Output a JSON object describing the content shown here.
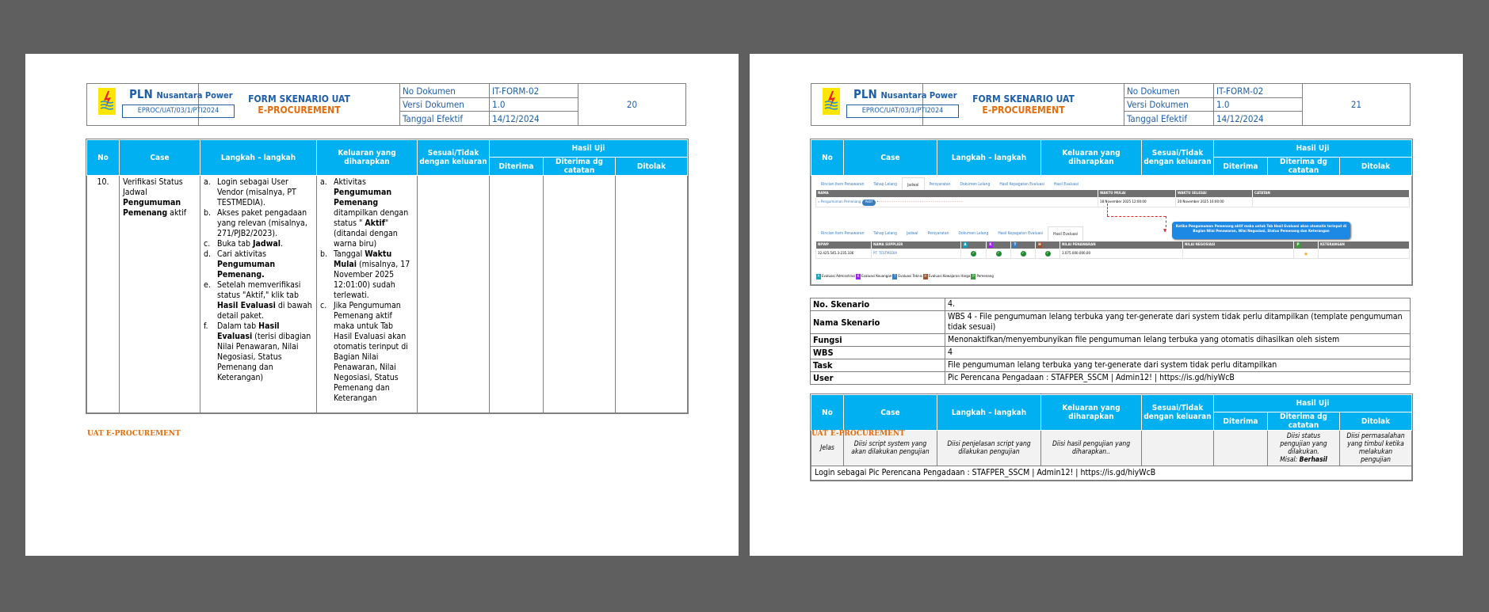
{
  "header": {
    "company": "PLN",
    "company_sub": "Nusantara Power",
    "doc_code": "EPROC/UAT/03/1/PTI2024",
    "form_title": "FORM SKENARIO UAT",
    "form_subtitle": "E-PROCUREMENT",
    "labels": [
      "No Dokumen",
      "Versi Dokumen",
      "Tanggal Efektif"
    ],
    "values": [
      "IT-FORM-02",
      "1.0",
      "14/12/2024"
    ]
  },
  "columns": {
    "no": "No",
    "case": "Case",
    "langkah": "Langkah – langkah",
    "keluaran": "Keluaran yang diharapkan",
    "sesuai": "Sesuai/Tidak dengan keluaran",
    "hasil": "Hasil Uji",
    "diterima": "Diterima",
    "catatan": "Diterima dg catatan",
    "ditolak": "Ditolak"
  },
  "footer": "UAT E-PROCUREMENT",
  "page1": {
    "page_number": "20",
    "row": {
      "no": "10.",
      "case": [
        [
          "Verifikasi Status Jadwal ",
          false
        ],
        [
          "Pengumuman Pemenang",
          true
        ],
        [
          " aktif",
          false
        ]
      ],
      "steps": [
        {
          "m": "a.",
          "t": [
            [
              "Login sebagai User Vendor (misalnya, PT TESTMEDIA).",
              false
            ]
          ]
        },
        {
          "m": "b.",
          "t": [
            [
              "Akses paket pengadaan yang relevan (misalnya, 271/PJB2/2023).",
              false
            ]
          ]
        },
        {
          "m": "c.",
          "t": [
            [
              "Buka tab ",
              false
            ],
            [
              "Jadwal",
              true
            ],
            [
              ".",
              false
            ]
          ]
        },
        {
          "m": "d.",
          "t": [
            [
              "Cari aktivitas ",
              false
            ],
            [
              "Pengumuman Pemenang.",
              true
            ]
          ]
        },
        {
          "m": "e.",
          "t": [
            [
              "Setelah memverifikasi status \"Aktif,\" klik tab ",
              false
            ],
            [
              "Hasil Evaluasi",
              true
            ],
            [
              " di bawah detail paket.",
              false
            ]
          ]
        },
        {
          "m": "f.",
          "t": [
            [
              "Dalam tab ",
              false
            ],
            [
              "Hasil Evaluasi",
              true
            ],
            [
              " (terisi dibagian Nilai Penawaran, Nilai Negosiasi, Status Pemenang dan Keterangan)",
              false
            ]
          ]
        }
      ],
      "outputs": [
        {
          "m": "a.",
          "t": [
            [
              "Aktivitas ",
              false
            ],
            [
              "Pengumuman Pemenang",
              true
            ],
            [
              " ditampilkan dengan status \" ",
              false
            ],
            [
              "Aktif",
              true
            ],
            [
              "\" (ditandai dengan warna biru)",
              false
            ]
          ]
        },
        {
          "m": "b.",
          "t": [
            [
              "Tanggal ",
              false
            ],
            [
              "Waktu Mulai",
              true
            ],
            [
              " (misalnya, 17 November 2025 12:01:00) sudah terlewati.",
              false
            ]
          ]
        },
        {
          "m": "c.",
          "t": [
            [
              "Jika Pengumuman Pemenang aktif maka untuk Tab Hasil Evaluasi akan otomatis terinput di Bagian Nilai Penawaran, Nilai Negosiasi, Status Pemenang dan Keterangan",
              false
            ]
          ]
        }
      ]
    }
  },
  "page2": {
    "page_number": "21",
    "screenshot": {
      "tabs1": [
        "Rincian Item Penawaran",
        "Tahap Lelang",
        "Jadwal",
        "Persyaratan",
        "Dokumen Lelang",
        "Hasil Kepagatan Evaluasi",
        "Hasil Evaluasi"
      ],
      "active1": "Jadwal",
      "sched_headers": [
        "NAMA",
        "WAKTU MULAI",
        "WAKTU SELESAI",
        "CATATAN"
      ],
      "sched_row": {
        "name": "» Pengumuman Pemenang",
        "badge": "Aktif",
        "start": "18 November 2025 12:00:00",
        "end": "20 November 2025 16:00:00"
      },
      "callout": "Ketika Pengumuman Pemenang aktif maka untuk Tab Hasil Evaluasi akan otomatis terinput di Bagian Nilai Penawaran, Nilai Negosiasi, Status Pemenang dan Keterangan",
      "tabs2": [
        "Rincian Item Penawaran",
        "Tahap Lelang",
        "Jadwal",
        "Persyaratan",
        "Dokumen Lelang",
        "Hasil Kepagatan Evaluasi",
        "Hasil Evaluasi"
      ],
      "active2": "Hasil Evaluasi",
      "eval_headers": [
        "NPWP",
        "NAMA SUPPLIER",
        "A",
        "K",
        "T",
        "H",
        "NILAI PENAWARAN",
        "NILAI NEGOSIASI",
        "P",
        "KETERANGAN"
      ],
      "eval_row": {
        "npwp": "32.425.545.3-235.336",
        "supplier": "PT. TESTMEDIA",
        "penawaran": "3.075.000.000,00"
      },
      "legend": [
        {
          "k": "A",
          "label": "Evaluasi Adminstrasi",
          "color": "#17a2b8"
        },
        {
          "k": "K",
          "label": "Evaluasi Keuangan",
          "color": "#a020f0"
        },
        {
          "k": "T",
          "label": "Evaluasi Teknis",
          "color": "#3a7ec2"
        },
        {
          "k": "H",
          "label": "Evaluasi Kewajaran Harga",
          "color": "#a0522d"
        },
        {
          "k": "P",
          "label": "Pemenang",
          "color": "#3c9a3c"
        }
      ]
    },
    "skenario": [
      {
        "k": "No. Skenario",
        "v": "4."
      },
      {
        "k": "Nama Skenario",
        "v": "WBS 4 - File pengumuman lelang terbuka yang ter-generate dari system tidak perlu ditampilkan (template pengumuman tidak sesuai)"
      },
      {
        "k": "Fungsi",
        "v": "Menonaktifkan/menyembunyikan file pengumuman lelang terbuka yang otomatis dihasilkan oleh sistem"
      },
      {
        "k": "WBS",
        "v": "4"
      },
      {
        "k": "Task",
        "v": "File pengumuman lelang terbuka yang ter-generate dari system tidak perlu ditampilkan"
      },
      {
        "k": "User",
        "v": "Pic Perencana Pengadaan : STAFPER_SSCM | Admin12! | https://is.gd/hiyWcB"
      }
    ],
    "template_row": {
      "no": "Jelas",
      "case": "Diisi script system yang akan dilakukan pengujian",
      "langkah": "Diisi penjelasan script yang dilakukan pengujian",
      "keluaran": "Diisi hasil pengujian yang diharapkan..",
      "catatan": "Diisi status pengujian yang dilakukan.",
      "catatan_misal": "Misal: ",
      "catatan_bold": "Berhasil",
      "ditolak": "Diisi permasalahan yang timbul ketika melakukan pengujian"
    },
    "login_row": "Login sebagai Pic Perencana Pengadaan : STAFPER_SSCM | Admin12! | https://is.gd/hiyWcB"
  }
}
